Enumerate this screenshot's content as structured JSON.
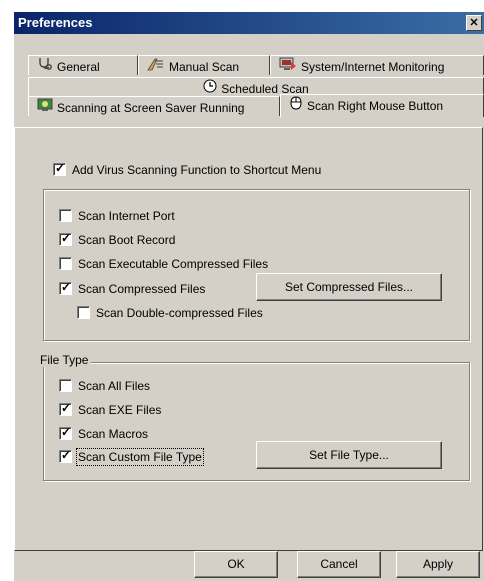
{
  "window": {
    "title": "Preferences",
    "close_label": "✕"
  },
  "tabs": {
    "general": "General",
    "manual_scan": "Manual Scan",
    "system_internet": "System/Internet Monitoring",
    "scheduled_scan": "Scheduled Scan",
    "screen_saver": "Scanning at Screen Saver Running",
    "right_mouse": "Scan Right Mouse Button"
  },
  "options": {
    "add_shortcut": {
      "label": "Add Virus Scanning Function to Shortcut Menu",
      "checked": true
    },
    "scan_internet_port": {
      "label": "Scan Internet Port",
      "checked": false
    },
    "scan_boot_record": {
      "label": "Scan Boot Record",
      "checked": true
    },
    "scan_executable_compressed": {
      "label": "Scan Executable Compressed Files",
      "checked": false
    },
    "scan_compressed": {
      "label": "Scan Compressed Files",
      "checked": true
    },
    "scan_double_compressed": {
      "label": "Scan Double-compressed Files",
      "checked": false
    },
    "set_compressed_button": "Set Compressed Files..."
  },
  "file_type": {
    "group_label": "File Type",
    "scan_all": {
      "label": "Scan All Files",
      "checked": false
    },
    "scan_exe": {
      "label": "Scan EXE Files",
      "checked": true
    },
    "scan_macros": {
      "label": "Scan Macros",
      "checked": true
    },
    "scan_custom": {
      "label": "Scan Custom File Type",
      "checked": true
    },
    "set_file_type_button": "Set File Type..."
  },
  "footer": {
    "ok": "OK",
    "cancel": "Cancel",
    "apply": "Apply"
  }
}
